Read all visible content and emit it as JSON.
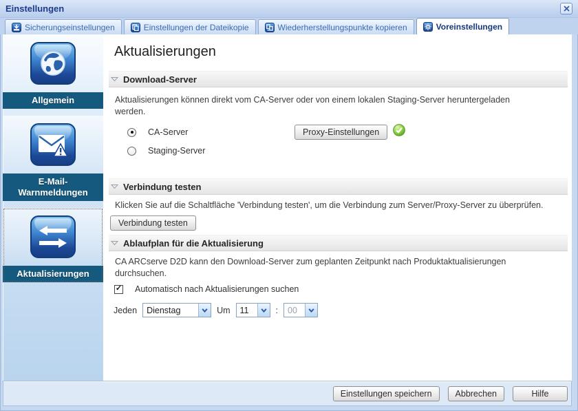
{
  "window": {
    "title": "Einstellungen",
    "close_icon": "close-icon"
  },
  "tabs": {
    "items": [
      {
        "label": "Sicherungseinstellungen",
        "icon": "backup-settings-icon",
        "active": false
      },
      {
        "label": "Einstellungen der Dateikopie",
        "icon": "file-copy-settings-icon",
        "active": false
      },
      {
        "label": "Wiederherstellungspunkte kopieren",
        "icon": "copy-recovery-points-icon",
        "active": false
      },
      {
        "label": "Voreinstellungen",
        "icon": "preferences-gear-icon",
        "active": true
      }
    ]
  },
  "sidebar": {
    "items": [
      {
        "label": "Allgemein",
        "icon": "globe-icon",
        "selected": false
      },
      {
        "label": "E-Mail-Warnmeldungen",
        "icon": "email-alert-icon",
        "selected": false
      },
      {
        "label": "Aktualisierungen",
        "icon": "sync-arrows-icon",
        "selected": true
      }
    ]
  },
  "content": {
    "page_title": "Aktualisierungen",
    "download_server": {
      "heading": "Download-Server",
      "description": "Aktualisierungen können direkt vom CA-Server oder von einem lokalen Staging-Server heruntergeladen werden.",
      "radio_ca_label": "CA-Server",
      "radio_ca_checked": true,
      "radio_staging_label": "Staging-Server",
      "radio_staging_checked": false,
      "proxy_button_label": "Proxy-Einstellungen",
      "proxy_status_icon": "green-check-icon"
    },
    "test_connection": {
      "heading": "Verbindung testen",
      "description": "Klicken Sie auf die Schaltfläche 'Verbindung testen', um die Verbindung zum Server/Proxy-Server zu überprüfen.",
      "button_label": "Verbindung testen"
    },
    "update_schedule": {
      "heading": "Ablaufplan für die Aktualisierung",
      "description": "CA ARCserve D2D kann den Download-Server zum geplanten Zeitpunkt nach Produktaktualisierungen durchsuchen.",
      "auto_check_label": "Automatisch nach Aktualisierungen suchen",
      "auto_check_checked": true,
      "every_label": "Jeden",
      "day_select_value": "Dienstag",
      "at_label": "Um",
      "hour_select_value": "11",
      "time_separator": ":",
      "minute_select_value": "00",
      "minute_select_disabled": true
    }
  },
  "footer": {
    "save_button": "Einstellungen speichern",
    "cancel_button": "Abbrechen",
    "help_button": "Hilfe"
  },
  "colors": {
    "titlebar_text": "#1b3c8c",
    "sidebar_label_bar": "#15597e",
    "icon_tile_blue": "#1c4896",
    "status_green": "#67bb2f"
  }
}
